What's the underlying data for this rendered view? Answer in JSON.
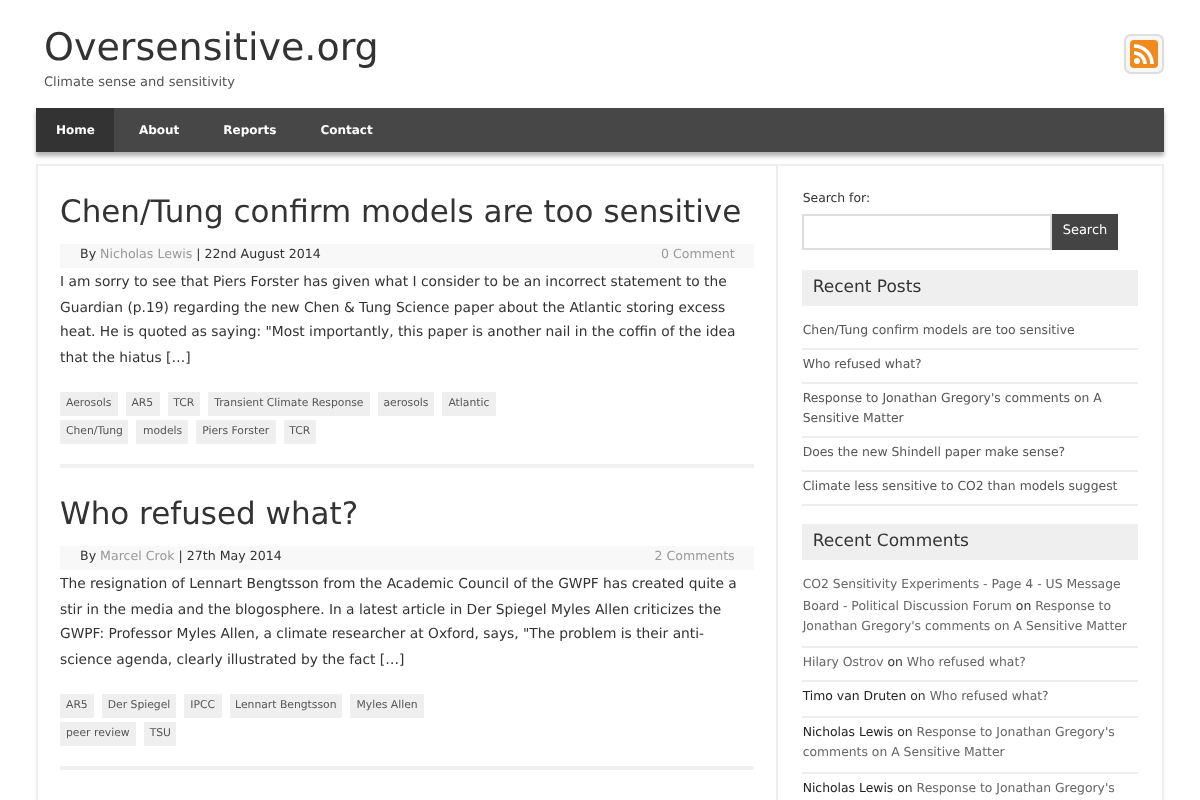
{
  "site": {
    "title": "Oversensitive.org",
    "tagline": "Climate sense and sensitivity"
  },
  "nav": [
    {
      "label": "Home",
      "selected": true
    },
    {
      "label": "About",
      "selected": false
    },
    {
      "label": "Reports",
      "selected": false
    },
    {
      "label": "Contact",
      "selected": false
    }
  ],
  "posts": [
    {
      "title": "Chen/Tung confirm models are too sensitive",
      "by": "By",
      "author": "Nicholas Lewis",
      "date": "| 22nd August 2014",
      "comments": "0 Comment",
      "excerpt": "I am sorry to see that Piers Forster has given what I consider to be an incorrect statement to the Guardian (p.19) regarding the new Chen & Tung Science paper about the Atlantic storing excess heat. He is quoted as saying: \"Most importantly, this paper is another nail in the coffin of the idea that the hiatus […]",
      "tags": [
        "Aerosols",
        "AR5",
        "TCR",
        "Transient Climate Response",
        "aerosols",
        "Atlantic",
        "Chen/Tung",
        "models",
        "Piers Forster",
        "TCR"
      ]
    },
    {
      "title": "Who refused what?",
      "by": "By",
      "author": "Marcel Crok",
      "date": "| 27th May 2014",
      "comments": "2 Comments",
      "excerpt": "The resignation of Lennart Bengtsson from the Academic Council of the GWPF has created quite a stir in the media and the blogosphere. In a latest article in Der Spiegel Myles Allen criticizes the GWPF: Professor Myles Allen, a climate researcher at Oxford, says, \"The problem is their anti-science agenda, clearly illustrated by the fact […]",
      "tags": [
        "AR5",
        "Der Spiegel",
        "IPCC",
        "Lennart Bengtsson",
        "Myles Allen",
        "peer review",
        "TSU"
      ]
    }
  ],
  "sidebar": {
    "search_label": "Search for:",
    "search_button": "Search",
    "recent_posts": {
      "heading": "Recent Posts",
      "items": [
        "Chen/Tung confirm models are too sensitive",
        "Who refused what?",
        "Response to Jonathan Gregory's comments on A Sensitive Matter",
        "Does the new Shindell paper make sense?",
        "Climate less sensitive to CO2 than models suggest"
      ]
    },
    "recent_comments": {
      "heading": "Recent Comments",
      "items": [
        {
          "author": "CO2 Sensitivity Experiments - Page 4 - US Message Board - Political Discussion Forum",
          "author_link": true,
          "on": "on",
          "post": "Response to Jonathan Gregory's comments on A Sensitive Matter"
        },
        {
          "author": "Hilary Ostrov",
          "author_link": true,
          "on": "on",
          "post": "Who refused what?"
        },
        {
          "author": "Timo van Druten",
          "author_link": false,
          "on": "on",
          "post": "Who refused what?"
        },
        {
          "author": "Nicholas Lewis",
          "author_link": false,
          "on": "on",
          "post": "Response to Jonathan Gregory's comments on A Sensitive Matter"
        },
        {
          "author": "Nicholas Lewis",
          "author_link": false,
          "on": "on",
          "post": "Response to Jonathan Gregory's"
        }
      ]
    }
  }
}
